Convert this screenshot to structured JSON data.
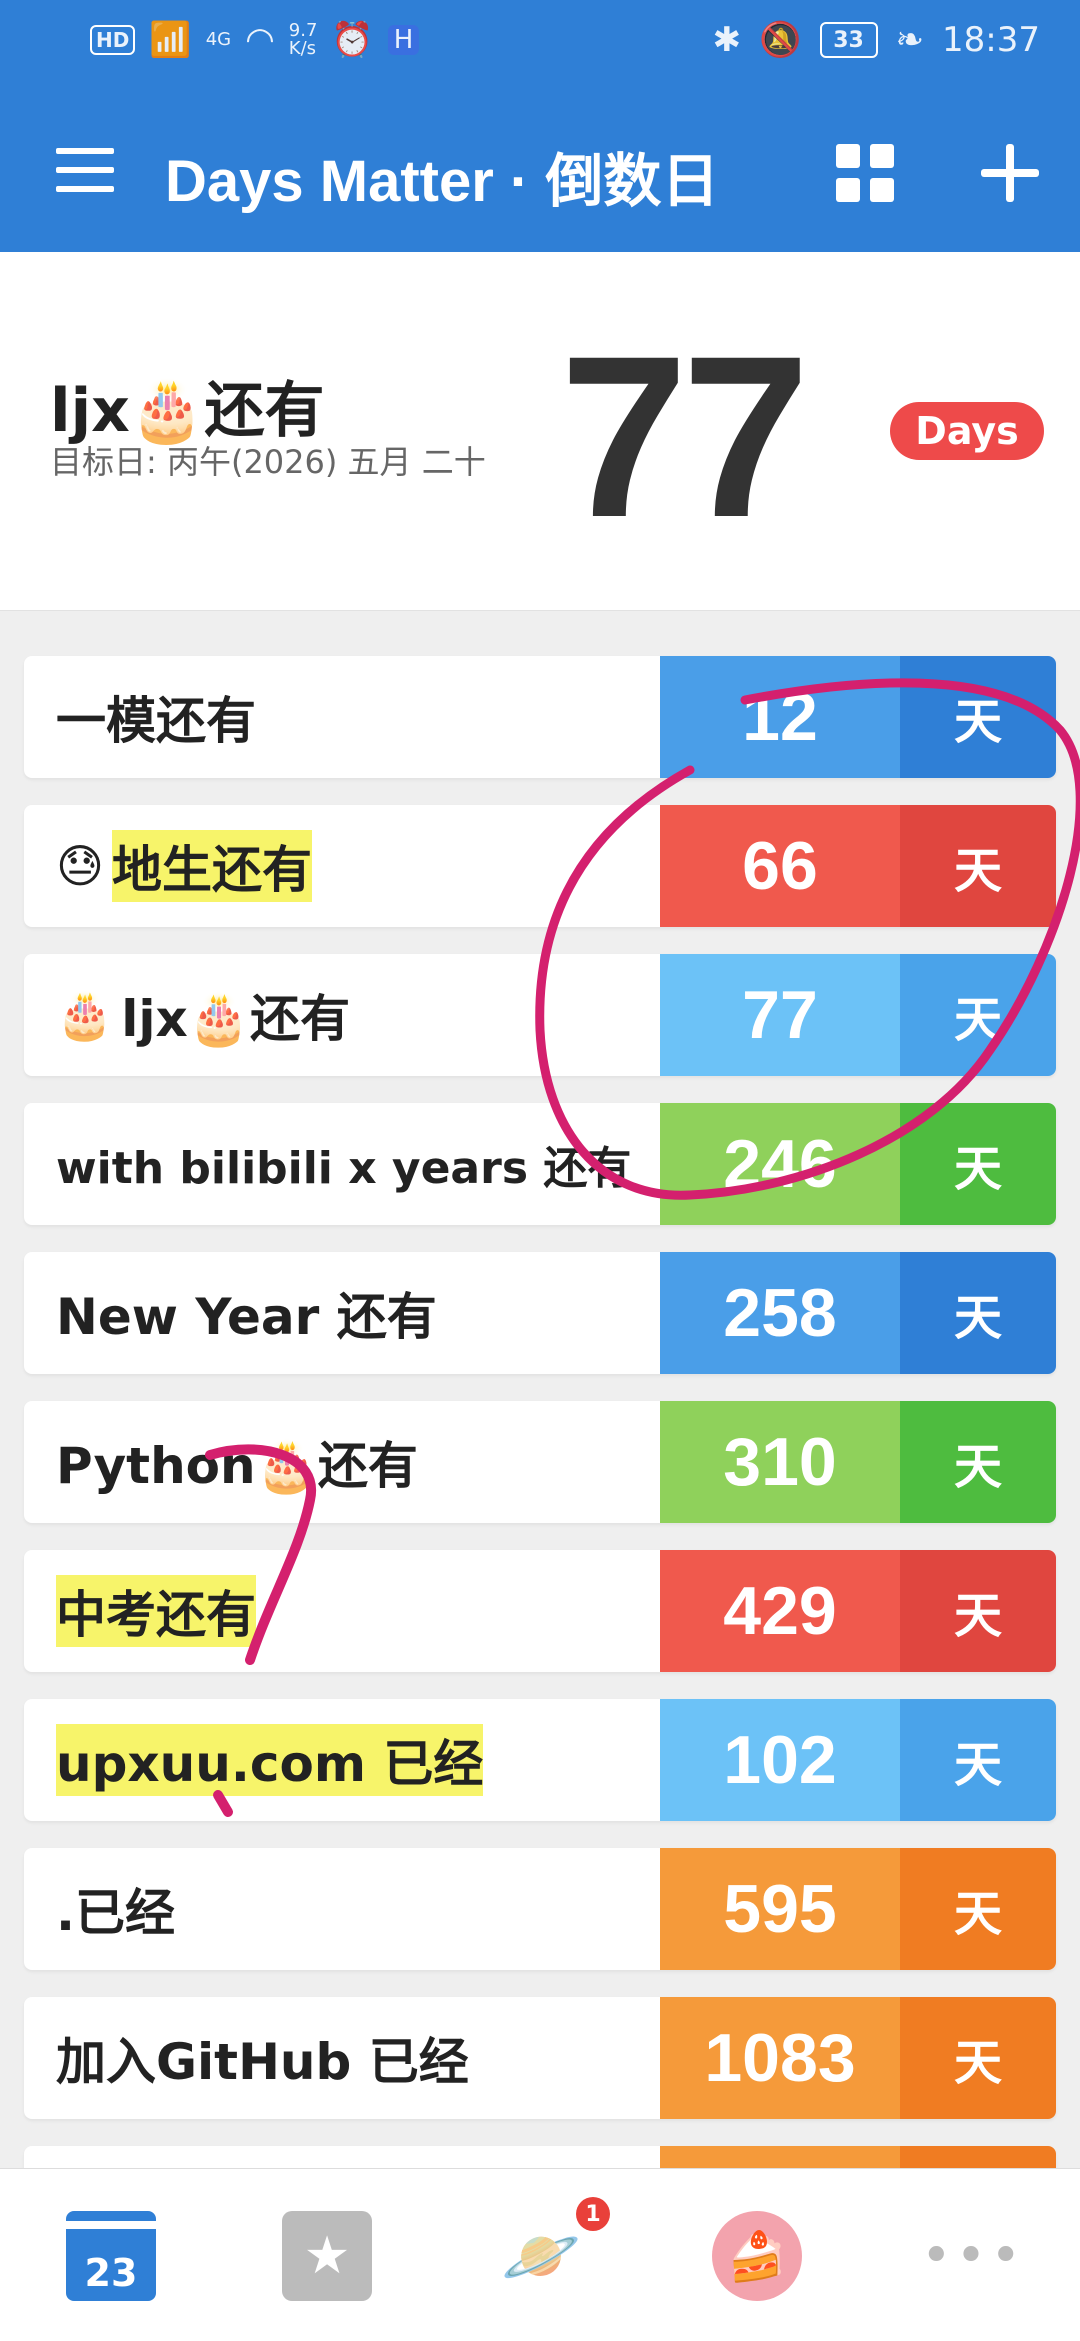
{
  "status_bar": {
    "hd": "HD",
    "network": "4G",
    "speed_value": "9.7",
    "speed_unit": "K/s",
    "battery": "33",
    "time": "18:37"
  },
  "app_bar": {
    "title": "Days Matter · 倒数日"
  },
  "hero": {
    "title": "ljx🎂还有",
    "subtitle": "目标日: 丙午(2026) 五月 二十",
    "number": "77",
    "badge": "Days"
  },
  "events": [
    {
      "label": "一模还有",
      "value": "12",
      "unit": "天",
      "highlight": false,
      "emoji": "",
      "num_color": "#4a9ee8",
      "unit_color": "#2f7fd6"
    },
    {
      "label": "地生还有",
      "value": "66",
      "unit": "天",
      "highlight": true,
      "emoji": "😓",
      "num_color": "#f0594d",
      "unit_color": "#e0463f"
    },
    {
      "label": "ljx🎂还有",
      "value": "77",
      "unit": "天",
      "highlight": false,
      "emoji": "🎂",
      "num_color": "#6cc2f7",
      "unit_color": "#4aa3ea"
    },
    {
      "label": "with bilibili x years 还有",
      "value": "246",
      "unit": "天",
      "highlight": false,
      "emoji": "",
      "num_color": "#8fd15b",
      "unit_color": "#4ebc3f"
    },
    {
      "label": "New Year 还有",
      "value": "258",
      "unit": "天",
      "highlight": false,
      "emoji": "",
      "num_color": "#4a9ee8",
      "unit_color": "#2f7fd6"
    },
    {
      "label": "Python🎂还有",
      "value": "310",
      "unit": "天",
      "highlight": false,
      "emoji": "",
      "num_color": "#8fd15b",
      "unit_color": "#4ebc3f"
    },
    {
      "label": "中考还有",
      "value": "429",
      "unit": "天",
      "highlight": true,
      "emoji": "",
      "num_color": "#f0594d",
      "unit_color": "#e0463f"
    },
    {
      "label": "upxuu.com 已经",
      "value": "102",
      "unit": "天",
      "highlight": true,
      "emoji": "",
      "num_color": "#6cc2f7",
      "unit_color": "#4aa3ea"
    },
    {
      "label": ".已经",
      "value": "595",
      "unit": "天",
      "highlight": false,
      "emoji": "",
      "num_color": "#f59a3a",
      "unit_color": "#f07c22"
    },
    {
      "label": "加入GitHub 已经",
      "value": "1083",
      "unit": "天",
      "highlight": false,
      "emoji": "",
      "num_color": "#f59a3a",
      "unit_color": "#f07c22"
    }
  ],
  "bottom_nav": {
    "calendar_day": "23",
    "notification_count": "1",
    "more": "•••"
  },
  "icons": {
    "menu": "hamburger-icon",
    "grid": "grid-icon",
    "add": "plus-icon",
    "calendar": "calendar-icon",
    "favorites": "star-list-icon",
    "discover": "planet-icon",
    "birthday": "cake-icon",
    "more": "more-icon"
  }
}
